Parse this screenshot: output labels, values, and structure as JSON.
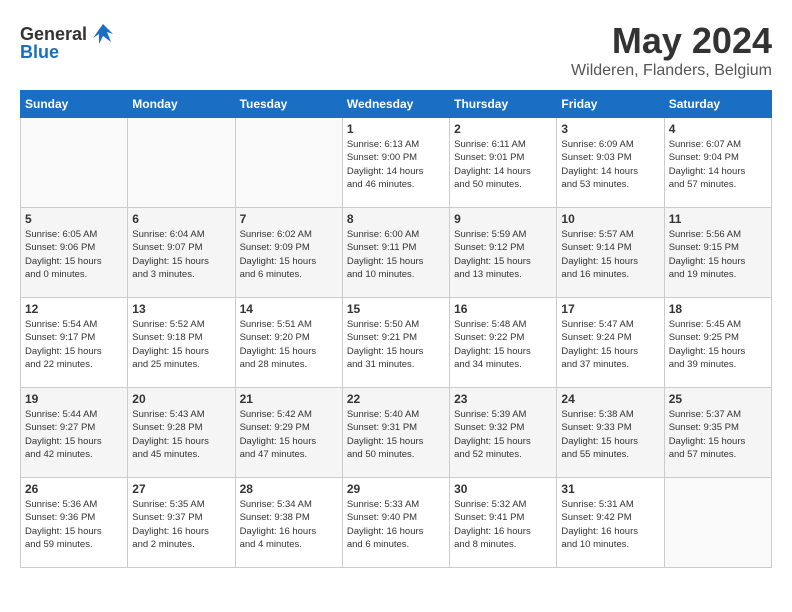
{
  "header": {
    "logo_general": "General",
    "logo_blue": "Blue",
    "month": "May 2024",
    "location": "Wilderen, Flanders, Belgium"
  },
  "days_of_week": [
    "Sunday",
    "Monday",
    "Tuesday",
    "Wednesday",
    "Thursday",
    "Friday",
    "Saturday"
  ],
  "weeks": [
    [
      {
        "day": "",
        "info": ""
      },
      {
        "day": "",
        "info": ""
      },
      {
        "day": "",
        "info": ""
      },
      {
        "day": "1",
        "info": "Sunrise: 6:13 AM\nSunset: 9:00 PM\nDaylight: 14 hours\nand 46 minutes."
      },
      {
        "day": "2",
        "info": "Sunrise: 6:11 AM\nSunset: 9:01 PM\nDaylight: 14 hours\nand 50 minutes."
      },
      {
        "day": "3",
        "info": "Sunrise: 6:09 AM\nSunset: 9:03 PM\nDaylight: 14 hours\nand 53 minutes."
      },
      {
        "day": "4",
        "info": "Sunrise: 6:07 AM\nSunset: 9:04 PM\nDaylight: 14 hours\nand 57 minutes."
      }
    ],
    [
      {
        "day": "5",
        "info": "Sunrise: 6:05 AM\nSunset: 9:06 PM\nDaylight: 15 hours\nand 0 minutes."
      },
      {
        "day": "6",
        "info": "Sunrise: 6:04 AM\nSunset: 9:07 PM\nDaylight: 15 hours\nand 3 minutes."
      },
      {
        "day": "7",
        "info": "Sunrise: 6:02 AM\nSunset: 9:09 PM\nDaylight: 15 hours\nand 6 minutes."
      },
      {
        "day": "8",
        "info": "Sunrise: 6:00 AM\nSunset: 9:11 PM\nDaylight: 15 hours\nand 10 minutes."
      },
      {
        "day": "9",
        "info": "Sunrise: 5:59 AM\nSunset: 9:12 PM\nDaylight: 15 hours\nand 13 minutes."
      },
      {
        "day": "10",
        "info": "Sunrise: 5:57 AM\nSunset: 9:14 PM\nDaylight: 15 hours\nand 16 minutes."
      },
      {
        "day": "11",
        "info": "Sunrise: 5:56 AM\nSunset: 9:15 PM\nDaylight: 15 hours\nand 19 minutes."
      }
    ],
    [
      {
        "day": "12",
        "info": "Sunrise: 5:54 AM\nSunset: 9:17 PM\nDaylight: 15 hours\nand 22 minutes."
      },
      {
        "day": "13",
        "info": "Sunrise: 5:52 AM\nSunset: 9:18 PM\nDaylight: 15 hours\nand 25 minutes."
      },
      {
        "day": "14",
        "info": "Sunrise: 5:51 AM\nSunset: 9:20 PM\nDaylight: 15 hours\nand 28 minutes."
      },
      {
        "day": "15",
        "info": "Sunrise: 5:50 AM\nSunset: 9:21 PM\nDaylight: 15 hours\nand 31 minutes."
      },
      {
        "day": "16",
        "info": "Sunrise: 5:48 AM\nSunset: 9:22 PM\nDaylight: 15 hours\nand 34 minutes."
      },
      {
        "day": "17",
        "info": "Sunrise: 5:47 AM\nSunset: 9:24 PM\nDaylight: 15 hours\nand 37 minutes."
      },
      {
        "day": "18",
        "info": "Sunrise: 5:45 AM\nSunset: 9:25 PM\nDaylight: 15 hours\nand 39 minutes."
      }
    ],
    [
      {
        "day": "19",
        "info": "Sunrise: 5:44 AM\nSunset: 9:27 PM\nDaylight: 15 hours\nand 42 minutes."
      },
      {
        "day": "20",
        "info": "Sunrise: 5:43 AM\nSunset: 9:28 PM\nDaylight: 15 hours\nand 45 minutes."
      },
      {
        "day": "21",
        "info": "Sunrise: 5:42 AM\nSunset: 9:29 PM\nDaylight: 15 hours\nand 47 minutes."
      },
      {
        "day": "22",
        "info": "Sunrise: 5:40 AM\nSunset: 9:31 PM\nDaylight: 15 hours\nand 50 minutes."
      },
      {
        "day": "23",
        "info": "Sunrise: 5:39 AM\nSunset: 9:32 PM\nDaylight: 15 hours\nand 52 minutes."
      },
      {
        "day": "24",
        "info": "Sunrise: 5:38 AM\nSunset: 9:33 PM\nDaylight: 15 hours\nand 55 minutes."
      },
      {
        "day": "25",
        "info": "Sunrise: 5:37 AM\nSunset: 9:35 PM\nDaylight: 15 hours\nand 57 minutes."
      }
    ],
    [
      {
        "day": "26",
        "info": "Sunrise: 5:36 AM\nSunset: 9:36 PM\nDaylight: 15 hours\nand 59 minutes."
      },
      {
        "day": "27",
        "info": "Sunrise: 5:35 AM\nSunset: 9:37 PM\nDaylight: 16 hours\nand 2 minutes."
      },
      {
        "day": "28",
        "info": "Sunrise: 5:34 AM\nSunset: 9:38 PM\nDaylight: 16 hours\nand 4 minutes."
      },
      {
        "day": "29",
        "info": "Sunrise: 5:33 AM\nSunset: 9:40 PM\nDaylight: 16 hours\nand 6 minutes."
      },
      {
        "day": "30",
        "info": "Sunrise: 5:32 AM\nSunset: 9:41 PM\nDaylight: 16 hours\nand 8 minutes."
      },
      {
        "day": "31",
        "info": "Sunrise: 5:31 AM\nSunset: 9:42 PM\nDaylight: 16 hours\nand 10 minutes."
      },
      {
        "day": "",
        "info": ""
      }
    ]
  ]
}
